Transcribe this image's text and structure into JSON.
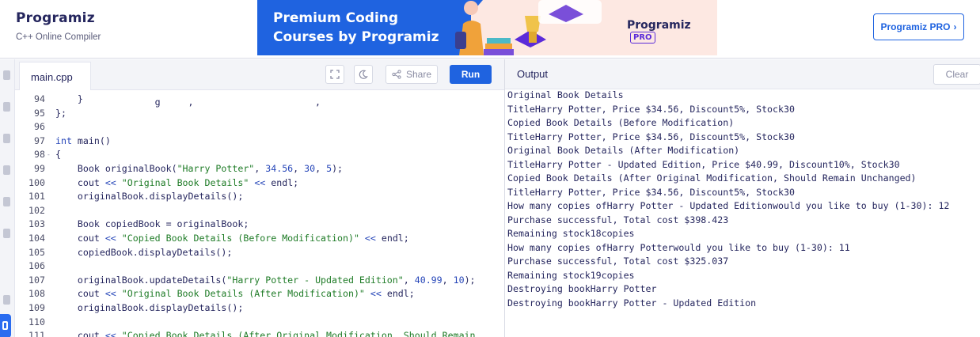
{
  "header": {
    "logo": "Programiz",
    "subtitle": "C++ Online Compiler",
    "banner": {
      "line1": "Premium Coding",
      "line2": "Courses by Programiz",
      "brand": "Programiz",
      "badge": "PRO"
    },
    "pro_button": "Programiz PRO",
    "pro_button_icon": "chevron-right-icon"
  },
  "editor": {
    "tab": "main.cpp",
    "share_label": "Share",
    "run_label": "Run",
    "lines": [
      {
        "n": "94",
        "fold": "",
        "text": "    }"
      },
      {
        "n": "95",
        "fold": "",
        "text": "};"
      },
      {
        "n": "96",
        "fold": "",
        "text": ""
      },
      {
        "n": "97",
        "fold": "",
        "text": "int main()"
      },
      {
        "n": "98",
        "fold": "-",
        "text": "{"
      },
      {
        "n": "99",
        "fold": "",
        "text": "    Book originalBook(\"Harry Potter\", 34.56, 30, 5);"
      },
      {
        "n": "100",
        "fold": "",
        "text": "    cout << \"Original Book Details\" << endl;"
      },
      {
        "n": "101",
        "fold": "",
        "text": "    originalBook.displayDetails();"
      },
      {
        "n": "102",
        "fold": "",
        "text": ""
      },
      {
        "n": "103",
        "fold": "",
        "text": "    Book copiedBook = originalBook;"
      },
      {
        "n": "104",
        "fold": "",
        "text": "    cout << \"Copied Book Details (Before Modification)\" << endl;"
      },
      {
        "n": "105",
        "fold": "",
        "text": "    copiedBook.displayDetails();"
      },
      {
        "n": "106",
        "fold": "",
        "text": ""
      },
      {
        "n": "107",
        "fold": "",
        "text": "    originalBook.updateDetails(\"Harry Potter - Updated Edition\", 40.99, 10);"
      },
      {
        "n": "108",
        "fold": "",
        "text": "    cout << \"Original Book Details (After Modification)\" << endl;"
      },
      {
        "n": "109",
        "fold": "",
        "text": "    originalBook.displayDetails();"
      },
      {
        "n": "110",
        "fold": "",
        "text": ""
      },
      {
        "n": "111",
        "fold": "",
        "text": "    cout << \"Copied Book Details (After Original Modification, Should Remain"
      }
    ]
  },
  "output": {
    "title": "Output",
    "clear_label": "Clear",
    "lines": [
      "Original Book Details",
      "TitleHarry Potter, Price $34.56, Discount5%, Stock30",
      "Copied Book Details (Before Modification)",
      "TitleHarry Potter, Price $34.56, Discount5%, Stock30",
      "Original Book Details (After Modification)",
      "TitleHarry Potter - Updated Edition, Price $40.99, Discount10%, Stock30",
      "Copied Book Details (After Original Modification, Should Remain Unchanged)",
      "TitleHarry Potter, Price $34.56, Discount5%, Stock30",
      "How many copies ofHarry Potter - Updated Editionwould you like to buy (1-30): 12",
      "Purchase successful, Total cost $398.423",
      "Remaining stock18copies",
      "How many copies ofHarry Potterwould you like to buy (1-30): 11",
      "Purchase successful, Total cost $325.037",
      "Remaining stock19copies",
      "Destroying bookHarry Potter",
      "Destroying bookHarry Potter - Updated Edition"
    ]
  },
  "colors": {
    "accent": "#1f63e0",
    "brand_purple": "#5b2bd9",
    "keyword": "#2545b8",
    "string": "#1e7b26"
  }
}
